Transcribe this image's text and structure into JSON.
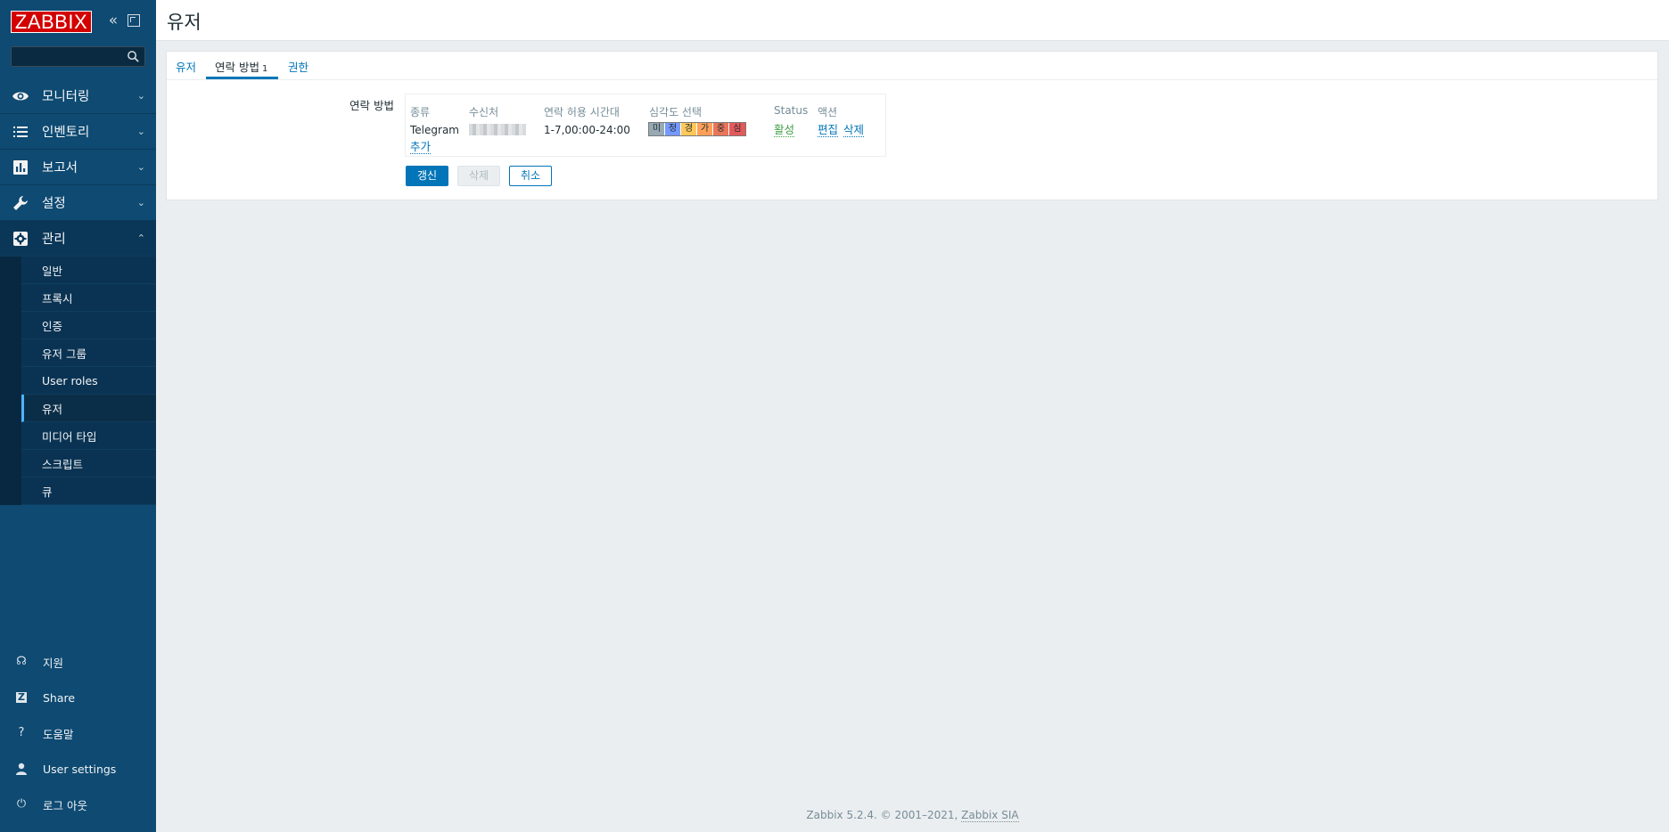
{
  "sidebar": {
    "logo_text": "ZABBIX",
    "search_placeholder": "",
    "menu": [
      {
        "label": "모니터링",
        "icon": "eye-icon"
      },
      {
        "label": "인벤토리",
        "icon": "list-icon"
      },
      {
        "label": "보고서",
        "icon": "bar-chart-icon"
      },
      {
        "label": "설정",
        "icon": "wrench-icon"
      },
      {
        "label": "관리",
        "icon": "gear-icon"
      }
    ],
    "admin_submenu": [
      "일반",
      "프록시",
      "인증",
      "유저 그룹",
      "User roles",
      "유저",
      "미디어 타입",
      "스크립트",
      "큐"
    ],
    "bottom": [
      {
        "label": "지원",
        "icon": "headset-icon"
      },
      {
        "label": "Share",
        "icon": "share-icon"
      },
      {
        "label": "도움말",
        "icon": "help-icon"
      },
      {
        "label": "User settings",
        "icon": "user-icon"
      },
      {
        "label": "로그 아웃",
        "icon": "power-icon"
      }
    ]
  },
  "header": {
    "title": "유저"
  },
  "tabs": [
    {
      "label": "유저"
    },
    {
      "label": "연락 방법",
      "badge": "1"
    },
    {
      "label": "권한"
    }
  ],
  "form": {
    "media_label": "연락 방법",
    "table_headers": [
      "종류",
      "수신처",
      "연락 허용 시간대",
      "심각도 선택",
      "Status",
      "액션"
    ],
    "rows": [
      {
        "type": "Telegram",
        "send_to": "",
        "when_active": "1-7,00:00-24:00",
        "severities": [
          "미",
          "정",
          "경",
          "가",
          "중",
          "심"
        ],
        "status": "활성",
        "actions": [
          "편집",
          "삭제"
        ]
      }
    ],
    "add_link": "추가",
    "buttons": {
      "update": "갱신",
      "delete": "삭제",
      "cancel": "취소"
    }
  },
  "severity_colors": [
    "#97aab3",
    "#7499ff",
    "#ffc859",
    "#ffa059",
    "#e97659",
    "#e45959"
  ],
  "footer": {
    "text": "Zabbix 5.2.4. © 2001–2021, ",
    "link": "Zabbix SIA"
  }
}
